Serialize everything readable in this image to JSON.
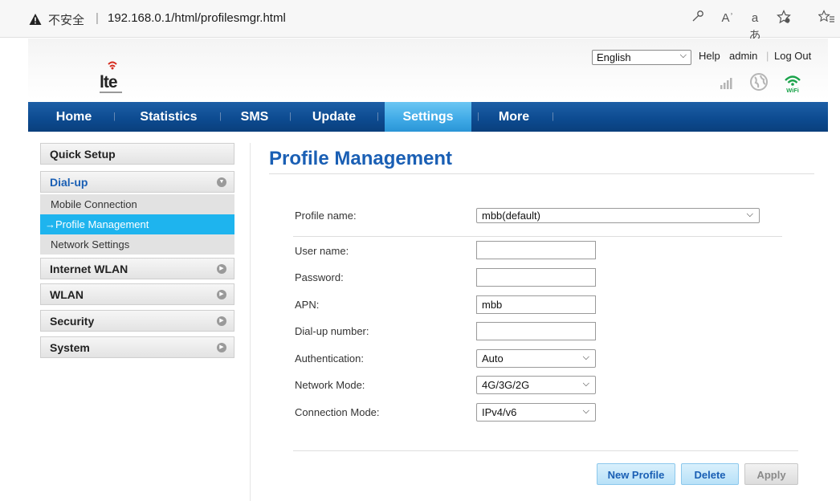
{
  "browser": {
    "insecure_label": "不安全",
    "separator": "|",
    "url": "192.168.0.1/html/profilesmgr.html",
    "icons": [
      "warning-icon",
      "key-icon",
      "read-aloud-icon",
      "translate-icon",
      "favorite-add-icon",
      "favorites-icon"
    ],
    "read_aloud_glyph": "Aʾ",
    "translate_glyph": "aあ"
  },
  "header": {
    "logo_text": "lte",
    "language": "English",
    "links": {
      "help": "Help",
      "user": "admin",
      "logout": "Log Out"
    }
  },
  "nav": {
    "items": [
      "Home",
      "Statistics",
      "SMS",
      "Update",
      "Settings",
      "More"
    ],
    "active": "Settings"
  },
  "sidebar": {
    "sections": [
      {
        "label": "Quick Setup"
      },
      {
        "label": "Dial-up",
        "open": true,
        "items": [
          "Mobile Connection",
          "Profile Management",
          "Network Settings"
        ]
      },
      {
        "label": "Internet WLAN"
      },
      {
        "label": "WLAN"
      },
      {
        "label": "Security"
      },
      {
        "label": "System"
      }
    ],
    "active_item": "→Profile Management"
  },
  "main": {
    "title": "Profile Management",
    "profile": {
      "label": "Profile name:",
      "value": "mbb(default)"
    },
    "fields": {
      "username": {
        "label": "User name:",
        "value": ""
      },
      "password": {
        "label": "Password:",
        "value": ""
      },
      "apn": {
        "label": "APN:",
        "value": "mbb"
      },
      "dialup": {
        "label": "Dial-up number:",
        "value": ""
      },
      "auth": {
        "label": "Authentication:",
        "value": "Auto"
      },
      "netmode": {
        "label": "Network Mode:",
        "value": "4G/3G/2G"
      },
      "connmode": {
        "label": "Connection Mode:",
        "value": "IPv4/v6"
      }
    },
    "buttons": {
      "new_profile": "New Profile",
      "delete": "Delete",
      "apply": "Apply"
    }
  },
  "colors": {
    "accent": "#1a5fb4",
    "nav_bg": "#0c4a8f",
    "nav_active": "#3fa9e6",
    "sidebar_active": "#1eb4ee"
  }
}
